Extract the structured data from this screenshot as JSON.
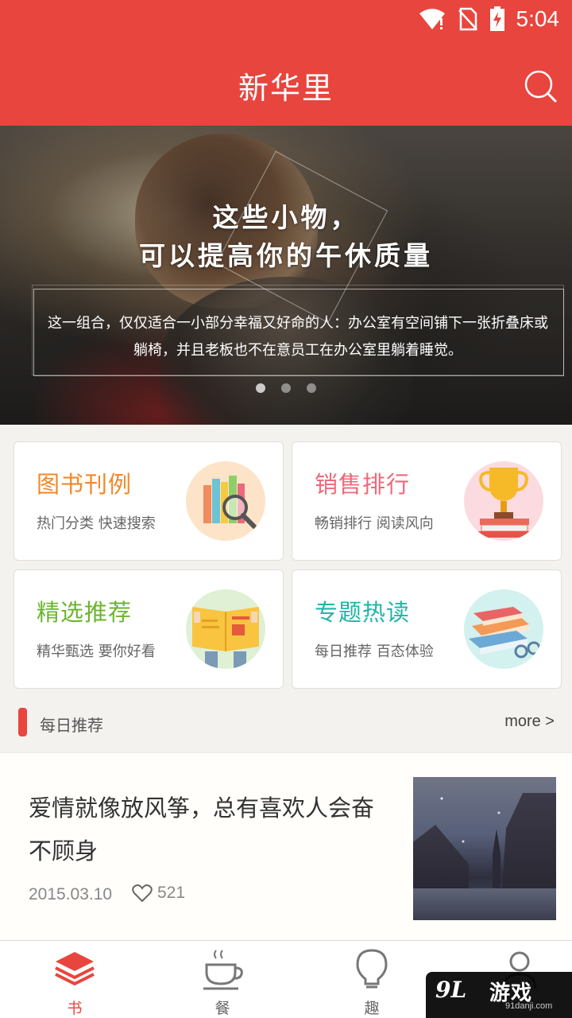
{
  "status_bar": {
    "time": "5:04"
  },
  "app_bar": {
    "title": "新华里"
  },
  "banner": {
    "title_line1": "这些小物，",
    "title_line2": "可以提高你的午休质量",
    "description": "这一组合，仅仅适合一小部分幸福又好命的人：办公室有空间铺下一张折叠床或躺椅，并且老板也不在意员工在办公室里躺着睡觉。",
    "active_dot": 0
  },
  "cards": [
    {
      "title": "图书刊例",
      "subtitle": "热门分类 快速搜索",
      "color": "#f2882a",
      "icon": "books-magnifier-icon",
      "icon_bg": "#fde4c8"
    },
    {
      "title": "销售排行",
      "subtitle": "畅销排行 阅读风向",
      "color": "#ec6a7a",
      "icon": "trophy-icon",
      "icon_bg": "#fbdbe0"
    },
    {
      "title": "精选推荐",
      "subtitle": "精华甄选 要你好看",
      "color": "#6bb52d",
      "icon": "reading-book-icon",
      "icon_bg": "#dff0d5"
    },
    {
      "title": "专题热读",
      "subtitle": "每日推荐  百态体验",
      "color": "#1fb5a8",
      "icon": "books-glasses-icon",
      "icon_bg": "#d2f1ef"
    }
  ],
  "section": {
    "title": "每日推荐",
    "more": "more >"
  },
  "article": {
    "title": "爱情就像放风筝，总有喜欢人会奋不顾身",
    "date": "2015.03.10",
    "likes": "521"
  },
  "bottom_nav": [
    {
      "label": "书",
      "icon": "layers-icon",
      "active": true
    },
    {
      "label": "餐",
      "icon": "coffee-cup-icon",
      "active": false
    },
    {
      "label": "趣",
      "icon": "lightbulb-icon",
      "active": false
    },
    {
      "label": "",
      "icon": "user-icon",
      "active": false
    }
  ],
  "watermark": {
    "logo": "9L",
    "text": "游戏",
    "url": "91danji.com"
  },
  "colors": {
    "primary": "#e8453e"
  }
}
